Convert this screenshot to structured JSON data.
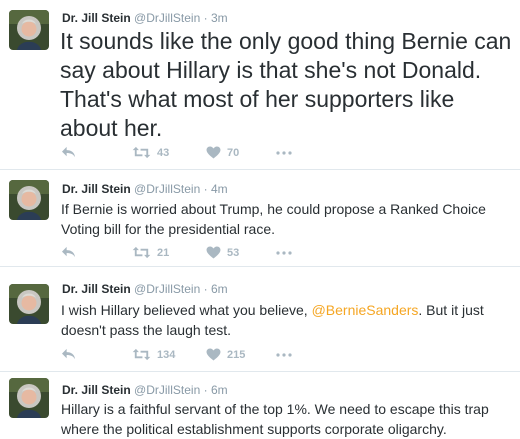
{
  "tweets": [
    {
      "author_name": "Dr. Jill Stein",
      "handle": "@DrJillStein",
      "separator": "·",
      "time": "3m",
      "text_before": "It sounds like the only good thing Bernie can say about Hillary is that she's not Donald. That's what most of her supporters like about her.",
      "mention": "",
      "text_after": "",
      "retweets": "43",
      "likes": "70"
    },
    {
      "author_name": "Dr. Jill Stein",
      "handle": "@DrJillStein",
      "separator": "·",
      "time": "4m",
      "text_before": "If Bernie is worried about Trump, he could propose a Ranked Choice Voting bill for the presidential race.",
      "mention": "",
      "text_after": "",
      "retweets": "21",
      "likes": "53"
    },
    {
      "author_name": "Dr. Jill Stein",
      "handle": "@DrJillStein",
      "separator": "·",
      "time": "6m",
      "text_before": "I wish Hillary believed what you believe, ",
      "mention": "@BernieSanders",
      "text_after": ". But it just doesn't pass the laugh test.",
      "retweets": "134",
      "likes": "215"
    },
    {
      "author_name": "Dr. Jill Stein",
      "handle": "@DrJillStein",
      "separator": "·",
      "time": "6m",
      "text_before": "Hillary is a faithful servant of the top 1%. We need to escape this trap where the political establishment supports corporate oligarchy.",
      "mention": "",
      "text_after": "",
      "retweets": "",
      "likes": ""
    }
  ],
  "icons": {
    "reply": "reply-icon",
    "retweet": "retweet-icon",
    "like": "heart-icon",
    "more": "more-icon"
  },
  "colors": {
    "text": "#292f33",
    "muted": "#8899a6",
    "icon": "#aab8c2",
    "mention": "#f5a623",
    "divider": "#e1e8ed"
  }
}
